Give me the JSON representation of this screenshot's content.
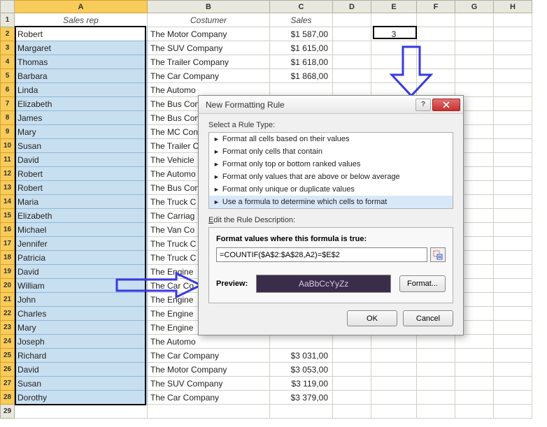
{
  "columns": [
    "A",
    "B",
    "C",
    "D",
    "E",
    "F",
    "G",
    "H"
  ],
  "headers": {
    "A": "Sales rep",
    "B": "Costumer",
    "C": "Sales"
  },
  "e2_value": "3",
  "rows": [
    {
      "n": 2,
      "rep": "Robert",
      "cust": "The Motor Company",
      "sales": "$1 587,00"
    },
    {
      "n": 3,
      "rep": "Margaret",
      "cust": "The SUV Company",
      "sales": "$1 615,00"
    },
    {
      "n": 4,
      "rep": "Thomas",
      "cust": "The Trailer Company",
      "sales": "$1 618,00"
    },
    {
      "n": 5,
      "rep": "Barbara",
      "cust": "The Car Company",
      "sales": "$1 868,00"
    },
    {
      "n": 6,
      "rep": "Linda",
      "cust": "The Automo",
      "sales": ""
    },
    {
      "n": 7,
      "rep": "Elizabeth",
      "cust": "The Bus Con",
      "sales": ""
    },
    {
      "n": 8,
      "rep": "James",
      "cust": "The Bus Con",
      "sales": ""
    },
    {
      "n": 9,
      "rep": "Mary",
      "cust": "The MC Con",
      "sales": ""
    },
    {
      "n": 10,
      "rep": "Susan",
      "cust": "The Trailer C",
      "sales": ""
    },
    {
      "n": 11,
      "rep": "David",
      "cust": "The Vehicle",
      "sales": ""
    },
    {
      "n": 12,
      "rep": "Robert",
      "cust": "The Automo",
      "sales": ""
    },
    {
      "n": 13,
      "rep": "Robert",
      "cust": "The Bus Con",
      "sales": ""
    },
    {
      "n": 14,
      "rep": "Maria",
      "cust": "The Truck C",
      "sales": ""
    },
    {
      "n": 15,
      "rep": "Elizabeth",
      "cust": "The Carriag",
      "sales": ""
    },
    {
      "n": 16,
      "rep": "Michael",
      "cust": "The Van Co",
      "sales": ""
    },
    {
      "n": 17,
      "rep": "Jennifer",
      "cust": "The Truck C",
      "sales": ""
    },
    {
      "n": 18,
      "rep": "Patricia",
      "cust": "The Truck C",
      "sales": ""
    },
    {
      "n": 19,
      "rep": "David",
      "cust": "The Engine",
      "sales": ""
    },
    {
      "n": 20,
      "rep": "William",
      "cust": "The Car Co",
      "sales": ""
    },
    {
      "n": 21,
      "rep": "John",
      "cust": "The Engine",
      "sales": ""
    },
    {
      "n": 22,
      "rep": "Charles",
      "cust": "The Engine",
      "sales": ""
    },
    {
      "n": 23,
      "rep": "Mary",
      "cust": "The Engine",
      "sales": ""
    },
    {
      "n": 24,
      "rep": "Joseph",
      "cust": "The Automo",
      "sales": ""
    },
    {
      "n": 25,
      "rep": "Richard",
      "cust": "The Car Company",
      "sales": "$3 031,00"
    },
    {
      "n": 26,
      "rep": "David",
      "cust": "The Motor Company",
      "sales": "$3 053,00"
    },
    {
      "n": 27,
      "rep": "Susan",
      "cust": "The SUV Company",
      "sales": "$3 119,00"
    },
    {
      "n": 28,
      "rep": "Dorothy",
      "cust": "The Car Company",
      "sales": "$3 379,00"
    }
  ],
  "dialog": {
    "title": "New Formatting Rule",
    "select_label": "Select a Rule Type:",
    "rule_types": [
      "Format all cells based on their values",
      "Format only cells that contain",
      "Format only top or bottom ranked values",
      "Format only values that are above or below average",
      "Format only unique or duplicate values",
      "Use a formula to determine which cells to format"
    ],
    "selected_rule_index": 5,
    "edit_label": "Edit the Rule Description:",
    "formula_label": "Format values where this formula is true:",
    "formula_value": "=COUNTIF($A$2:$A$28,A2)=$E$2",
    "preview_label": "Preview:",
    "preview_text": "AaBbCcYyZz",
    "format_button": "Format...",
    "ok_button": "OK",
    "cancel_button": "Cancel",
    "help_char": "?"
  }
}
